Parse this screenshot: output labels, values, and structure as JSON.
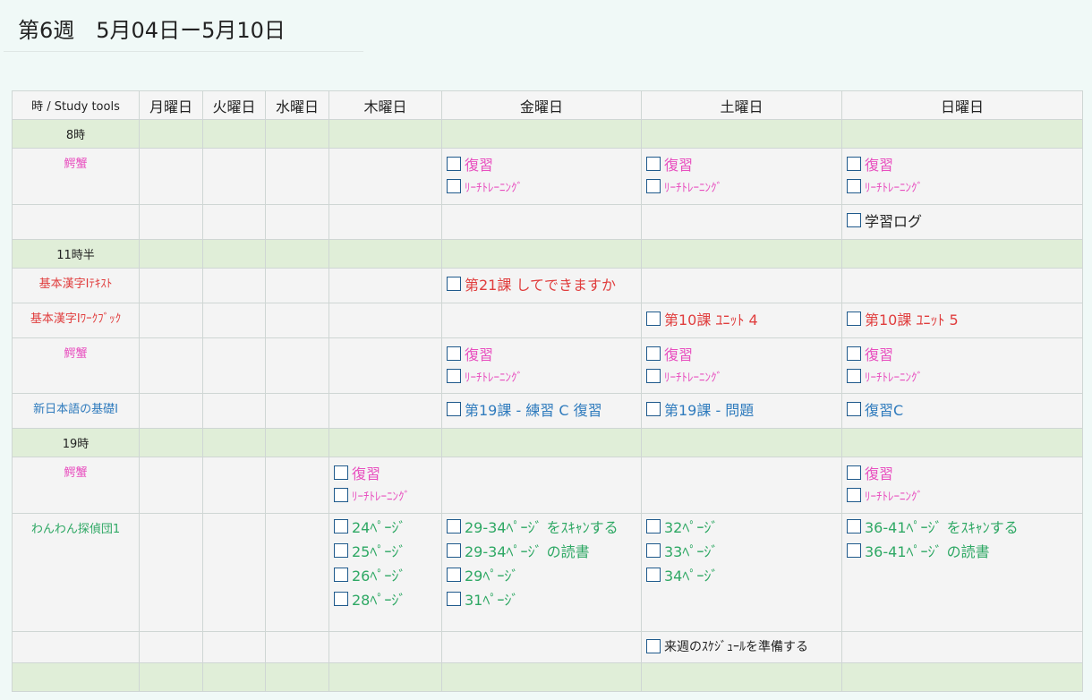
{
  "header": {
    "title": "第6週　5月04日ー5月10日"
  },
  "columns": [
    "時 / Study tools",
    "月曜日",
    "火曜日",
    "水曜日",
    "木曜日",
    "金曜日",
    "土曜日",
    "日曜日"
  ],
  "hours": {
    "h8": "8時",
    "h11": "11時半",
    "h19": "19時",
    "end": ""
  },
  "labels": {
    "kanikani": "鰐蟹",
    "kanji_text": "基本漢字Ⅰﾃｷｽﾄ",
    "kanji_workbook": "基本漢字Ⅰﾜｰｸﾌﾞｯｸ",
    "shin_nihongo": "新日本語の基礎Ⅰ",
    "wanwan": "わんわん探偵団1"
  },
  "tasks": {
    "fukushu": "復習",
    "reach": "ﾘｰﾁﾄﾚｰﾆﾝｸﾞ",
    "gakushu_log": "学習ログ",
    "kanji_fri": "第21課 してできますか",
    "wb_sat": "第10課 ﾕﾆｯﾄ 4",
    "wb_sun": "第10課 ﾕﾆｯﾄ 5",
    "sn_fri": "第19課 - 練習 C 復習",
    "sn_sat": "第19課 - 問題",
    "sn_sun": "復習C",
    "ww_thu": [
      "24ﾍﾟｰｼﾞ",
      "25ﾍﾟｰｼﾞ",
      "26ﾍﾟｰｼﾞ",
      "28ﾍﾟｰｼﾞ"
    ],
    "ww_fri": [
      "29-34ﾍﾟｰｼﾞ をｽｷｬﾝする",
      "29-34ﾍﾟｰｼﾞ の読書",
      "29ﾍﾟｰｼﾞ",
      "31ﾍﾟｰｼﾞ"
    ],
    "ww_sat": [
      "32ﾍﾟｰｼﾞ",
      "33ﾍﾟｰｼﾞ",
      "34ﾍﾟｰｼﾞ"
    ],
    "ww_sun": [
      "36-41ﾍﾟｰｼﾞ をｽｷｬﾝする",
      "36-41ﾍﾟｰｼﾞ の読書"
    ],
    "next_week": "来週のｽｹｼﾞｭｰﾙを準備する"
  },
  "colors": {
    "pink": "#e84fbf",
    "red": "#e03d3d",
    "blue": "#2f7bbd",
    "green": "#2ea864",
    "hour_row": "#e0eed8",
    "checkbox": "#1f5a8c"
  }
}
